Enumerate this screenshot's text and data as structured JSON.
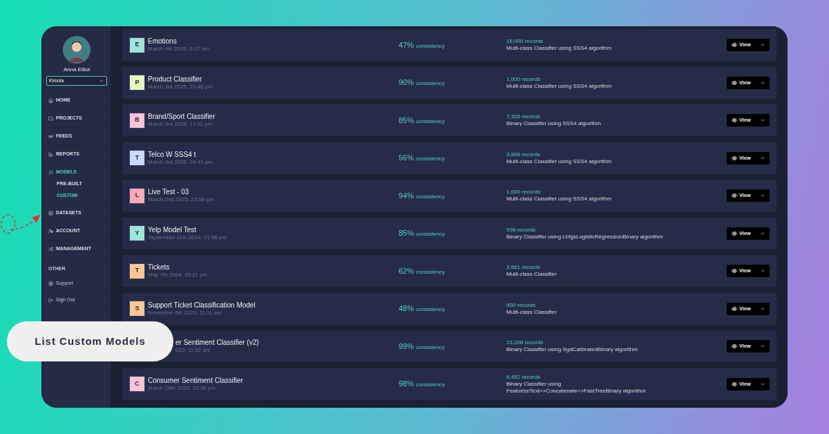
{
  "sidebar": {
    "user": {
      "name": "Anna Elliot"
    },
    "workspace_select": {
      "value": "Kimola"
    },
    "items": [
      {
        "kind": "item",
        "label": "HOME",
        "selected": false
      },
      {
        "kind": "item",
        "label": "PROJECTS",
        "selected": false
      },
      {
        "kind": "item",
        "label": "FEEDS",
        "selected": false
      },
      {
        "kind": "item",
        "label": "REPORTS",
        "selected": false
      },
      {
        "kind": "item",
        "label": "MODELS",
        "selected": true,
        "children": [
          {
            "label": "PRE-BUILT",
            "selected": false
          },
          {
            "label": "CUSTOM",
            "selected": true
          }
        ]
      },
      {
        "kind": "item",
        "label": "DATASETS",
        "selected": false
      },
      {
        "kind": "item",
        "label": "ACCOUNT",
        "selected": false
      },
      {
        "kind": "item",
        "label": "MANAGEMENT",
        "selected": false
      },
      {
        "kind": "heading",
        "label": "OTHER"
      },
      {
        "kind": "link",
        "label": "Support",
        "selected": false
      },
      {
        "kind": "link",
        "label": "Sign Out",
        "selected": false
      }
    ]
  },
  "models": [
    {
      "letter": "E",
      "color": "#9ee6d9",
      "name": "Emotions",
      "date": "March 4th 2025, 0:17 am",
      "consistency": "47%",
      "consistency_label": "consistency",
      "records": "16,000 records",
      "description": "Multi-class Classifier using SSS4 algorithm",
      "button": "View"
    },
    {
      "letter": "P",
      "color": "#e8f7bf",
      "name": "Product Classifier",
      "date": "March 3rd 2025, 20:48 pm",
      "consistency": "90%",
      "consistency_label": "consistency",
      "records": "1,000 records",
      "description": "Multi-class Classifier using SSS4 algorithm",
      "button": "View"
    },
    {
      "letter": "B",
      "color": "#fbc3d6",
      "name": "Brand/Sport Classifier",
      "date": "March 3rd 2025, 17:11 pm",
      "consistency": "85%",
      "consistency_label": "consistency",
      "records": "7,326 records",
      "description": "Binary Classifier using SSS4 algorithm",
      "button": "View"
    },
    {
      "letter": "T",
      "color": "#c9d8fb",
      "name": "Telco W SSS4 t",
      "date": "March 3rd 2025, 16:41 pm",
      "consistency": "56%",
      "consistency_label": "consistency",
      "records": "3,896 records",
      "description": "Multi-class Classifier using SSS4 algorithm",
      "button": "View"
    },
    {
      "letter": "L",
      "color": "#fbaab8",
      "name": "Live Test - 03",
      "date": "March 2nd 2025, 23:56 pm",
      "consistency": "94%",
      "consistency_label": "consistency",
      "records": "1,000 records",
      "description": "Multi-class Classifier using SSS4 algorithm",
      "button": "View"
    },
    {
      "letter": "Y",
      "color": "#9ee6d9",
      "name": "Yelp Model Test",
      "date": "September 11th 2024, 21:56 pm",
      "consistency": "85%",
      "consistency_label": "consistency",
      "records": "998 records",
      "description": "Binary Classifier using LbfgsLogisticRegressionBinary algorithm",
      "button": "View"
    },
    {
      "letter": "T",
      "color": "#fdc896",
      "name": "Tickets",
      "date": "May 7th 2024, 15:21 pm",
      "consistency": "62%",
      "consistency_label": "consistency",
      "records": "3,661 records",
      "description": "Multi-class Classifier",
      "button": "View"
    },
    {
      "letter": "S",
      "color": "#fdc896",
      "name": "Support Ticket Classification Model",
      "date": "November 6th 2023, 11:11 am",
      "consistency": "48%",
      "consistency_label": "consistency",
      "records": "900 records",
      "description": "Multi-class Classifier",
      "button": "View"
    },
    {
      "name": "er Sentiment Classifier (v2)",
      "date": "023, 11:02 am",
      "consistency": "99%",
      "consistency_label": "consistency",
      "records": "15,206 records",
      "description": "Binary Classifier using SgdCalibratedBinary algorithm",
      "button": "View"
    },
    {
      "letter": "C",
      "color": "#fbc3d6",
      "name": "Consumer Sentiment Classifier",
      "date": "March 24th 2023, 15:38 pm",
      "consistency": "98%",
      "consistency_label": "consistency",
      "records": "6,452 records",
      "description": "Binary Classifier using FeaturizeText=>Concatenate=>FastTreeBinary algorithm",
      "button": "View"
    }
  ],
  "callout": {
    "label": "List Custom Models"
  }
}
